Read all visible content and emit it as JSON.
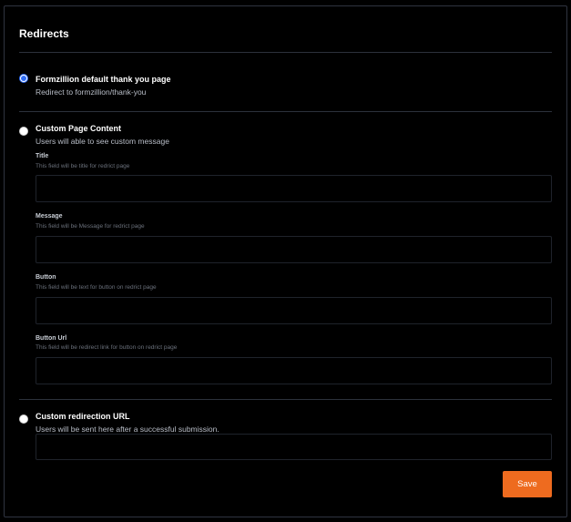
{
  "section": {
    "title": "Redirects"
  },
  "options": [
    {
      "label": "Formzillion default thank you page",
      "description": "Redirect to formzillion/thank-you",
      "checked": true
    },
    {
      "label": "Custom Page Content",
      "description": "Users will able to see custom message",
      "checked": false,
      "fields": [
        {
          "label": "Title",
          "help": "This field will be title for redrict page",
          "value": ""
        },
        {
          "label": "Message",
          "help": "This field will be Message for redrict page",
          "value": ""
        },
        {
          "label": "Button",
          "help": "This field will be text for button on redrict page",
          "value": ""
        },
        {
          "label": "Button Url",
          "help": "This field will be redirect link for button on redrict page",
          "value": ""
        }
      ]
    },
    {
      "label": "Custom redirection URL",
      "description": "Users will be sent here after a successful submission.",
      "checked": false,
      "value": ""
    }
  ],
  "actions": {
    "save_label": "Save"
  },
  "colors": {
    "accent": "#ee6b1f",
    "radio_selected": "#2f6df6",
    "border": "#2f3440"
  }
}
